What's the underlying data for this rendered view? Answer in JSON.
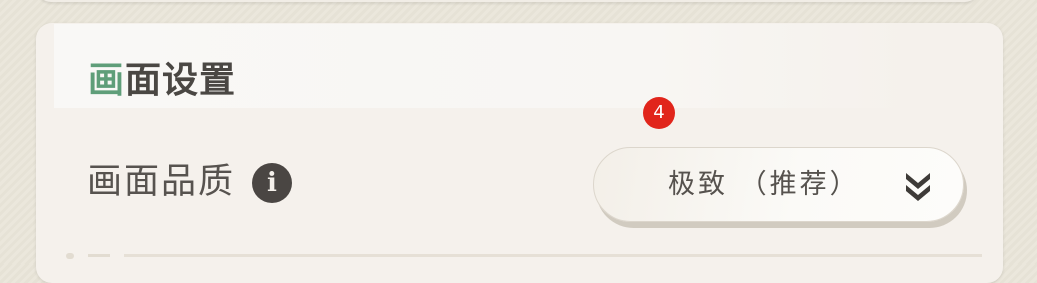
{
  "section": {
    "title_accent": "画",
    "title_rest": "面设置"
  },
  "quality_setting": {
    "label": "画面品质",
    "info_icon_glyph": "i",
    "selected_value": "极致 （推荐）",
    "badge_number": "4"
  },
  "icons": {
    "info": "info-circle-icon",
    "dropdown": "double-chevron-down-icon"
  },
  "colors": {
    "accent_green": "#5f9e79",
    "badge_red": "#e1251b",
    "text_dark": "#4a4743",
    "card_bg": "#f5f1ec"
  }
}
